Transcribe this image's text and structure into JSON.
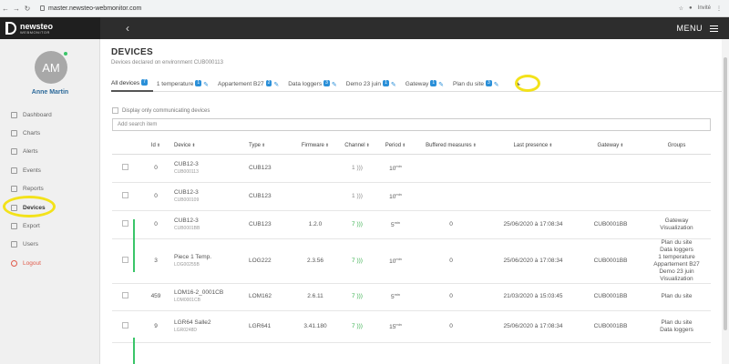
{
  "browser": {
    "url": "master.newsteo-webmonitor.com",
    "profile": "Invité"
  },
  "app": {
    "logo_main": "newsteo",
    "logo_sub": "WEBMONITOR",
    "menu_label": "MENU"
  },
  "user": {
    "initials": "AM",
    "name": "Anne Martin"
  },
  "sidebar": {
    "items": [
      {
        "label": "Dashboard",
        "icon": "dashboard-icon"
      },
      {
        "label": "Charts",
        "icon": "chart-icon"
      },
      {
        "label": "Alerts",
        "icon": "bell-icon"
      },
      {
        "label": "Events",
        "icon": "link-icon"
      },
      {
        "label": "Reports",
        "icon": "document-icon"
      },
      {
        "label": "Devices",
        "icon": "grid-icon"
      },
      {
        "label": "Export",
        "icon": "cloud-icon"
      },
      {
        "label": "Users",
        "icon": "users-icon"
      },
      {
        "label": "Logout",
        "icon": "power-icon"
      }
    ]
  },
  "page": {
    "title": "DEVICES",
    "subtitle": "Devices declared on environment CUB000113"
  },
  "tabs": [
    {
      "label": "All devices",
      "count": "7"
    },
    {
      "label": "1 temperature",
      "count": "1"
    },
    {
      "label": "Appartement B27",
      "count": "2"
    },
    {
      "label": "Data loggers",
      "count": "3"
    },
    {
      "label": "Demo 23 juin",
      "count": "1"
    },
    {
      "label": "Gateway",
      "count": "1"
    },
    {
      "label": "Plan du site",
      "count": "3"
    }
  ],
  "add_tab_label": "+",
  "filter_label": "Display only communicating devices",
  "search": {
    "placeholder": "Add search item"
  },
  "table": {
    "headers": {
      "id": "Id",
      "device": "Device",
      "type": "Type",
      "firmware": "Firmware",
      "channel": "Channel",
      "period": "Period",
      "buffered": "Buffered measures",
      "last_presence": "Last presence",
      "gateway": "Gateway",
      "groups": "Groups"
    },
    "rows": [
      {
        "id": "0",
        "device": "CUB12-3",
        "serial": "CUB000113",
        "type": "CUB123",
        "firmware": "",
        "channel": "1",
        "period": "10",
        "period_unit": "min",
        "buffered": "",
        "last_presence": "",
        "gateway": "",
        "groups": ""
      },
      {
        "id": "0",
        "device": "CUB12-3",
        "serial": "CUB000109",
        "type": "CUB123",
        "firmware": "",
        "channel": "1",
        "period": "10",
        "period_unit": "min",
        "buffered": "",
        "last_presence": "",
        "gateway": "",
        "groups": ""
      },
      {
        "id": "0",
        "device": "CUB12-3",
        "serial": "CUB0001BB",
        "type": "CUB123",
        "firmware": "1.2.0",
        "channel": "7",
        "period": "5",
        "period_unit": "min",
        "buffered": "0",
        "last_presence": "25/06/2020 à 17:08:34",
        "gateway": "CUB0001BB",
        "groups": "Gateway\nVisualization"
      },
      {
        "id": "3",
        "device": "Piece 1 Temp.",
        "serial": "LOG00255B",
        "type": "LOG222",
        "firmware": "2.3.56",
        "channel": "7",
        "period": "10",
        "period_unit": "min",
        "buffered": "0",
        "last_presence": "25/06/2020 à 17:08:34",
        "gateway": "CUB0001BB",
        "groups": "Plan du site\nData loggers\n1 temperature\nAppartement B27\nDemo 23 juin\nVisualization"
      },
      {
        "id": "459",
        "device": "LOM16-2_0001CB",
        "serial": "LOM0001CB",
        "type": "LOM162",
        "firmware": "2.6.11",
        "channel": "7",
        "period": "5",
        "period_unit": "min",
        "buffered": "0",
        "last_presence": "21/03/2020 à 15:03:45",
        "gateway": "CUB0001BB",
        "groups": "Plan du site"
      },
      {
        "id": "9",
        "device": "LGR64 Salle2",
        "serial": "LGR0248D",
        "type": "LGR641",
        "firmware": "3.41.180",
        "channel": "7",
        "period": "15",
        "period_unit": "min",
        "buffered": "0",
        "last_presence": "25/06/2020 à 17:08:34",
        "gateway": "CUB0001BB",
        "groups": "Plan du site\nData loggers"
      }
    ]
  },
  "colors": {
    "accent": "#2a8fd8",
    "online": "#3ac569",
    "highlight": "#f3e21a",
    "topbar": "#2d2d2d",
    "logout": "#e05a4a"
  }
}
